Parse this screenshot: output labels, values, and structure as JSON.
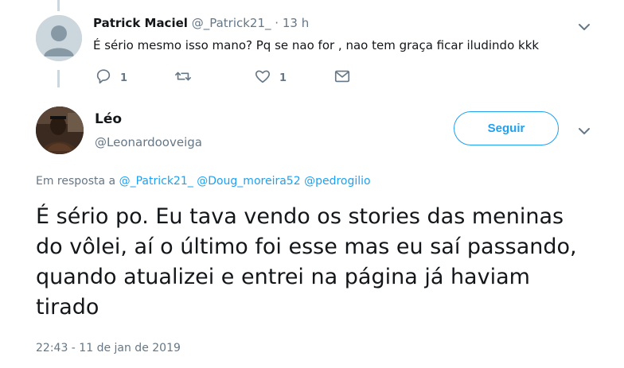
{
  "reply": {
    "name": "Patrick Maciel",
    "handle": "@_Patrick21_",
    "separator": "·",
    "time": "13 h",
    "text": "É sério mesmo isso mano? Pq se nao for , nao tem graça ficar iludindo kkk",
    "actions": {
      "reply_icon": "comment-icon",
      "reply_count": "1",
      "retweet_icon": "retweet-icon",
      "like_icon": "heart-icon",
      "like_count": "1",
      "dm_icon": "envelope-icon"
    }
  },
  "tweet": {
    "name": "Léo",
    "handle": "@Leonardooveiga",
    "follow_label": "Seguir",
    "in_reply_prefix": "Em resposta a",
    "mentions": [
      "@_Patrick21_",
      "@Doug_moreira52",
      "@pedrogilio"
    ],
    "text": "É sério po. Eu tava vendo os stories das meninas do vôlei, aí o último foi esse mas eu saí passando, quando atualizei e entrei na página já haviam tirado",
    "timestamp": "22:43 - 11 de jan de 2019"
  },
  "colors": {
    "accent": "#1da1f2",
    "muted": "#657786",
    "text": "#14171a",
    "divider": "#ccd6dd"
  }
}
